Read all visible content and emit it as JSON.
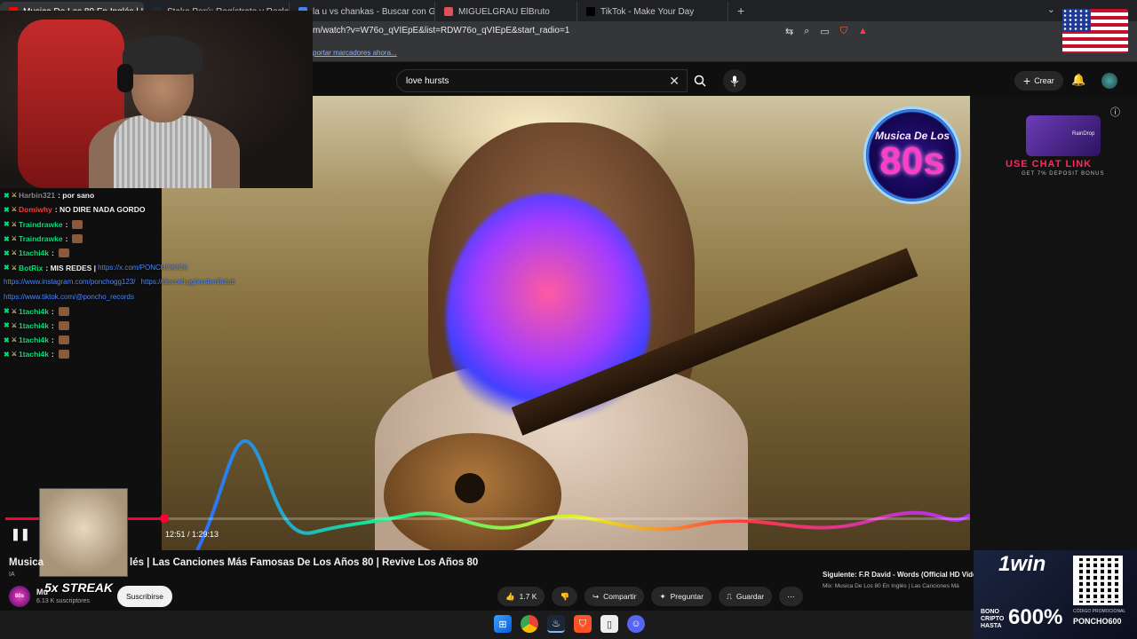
{
  "browser": {
    "tabs": [
      {
        "label": "Musica De Los 80 En Inglés | L",
        "active": true,
        "color": "#ff0000"
      },
      {
        "label": "Stake Perú: Regístrate y Reclama tu B",
        "active": false,
        "color": "#1a2c38"
      },
      {
        "label": "la u vs chankas - Buscar con Google",
        "active": false,
        "color": "#4285f4"
      },
      {
        "label": "MIGUELGRAU ElBruto",
        "active": false,
        "color": "#e0525a"
      },
      {
        "label": "TikTok - Make Your Day",
        "active": false,
        "color": "#000000"
      }
    ],
    "url": "m/watch?v=W76o_qVIEpE&list=RDW76o_qVIEpE&start_radio=1",
    "bookmark_link": "portar marcadores ahora..."
  },
  "youtube": {
    "search_value": "love hursts",
    "create_label": "Crear",
    "video": {
      "logo_top": "Musica De Los",
      "logo_number": "80s",
      "progress_fraction": 0.1645,
      "time_current": "12:51",
      "time_total": "1:29:13",
      "time_display": "12:51 / 1:29:13"
    },
    "title_left": "Musica",
    "title_right": "lés | Las Canciones Más Famosas De Los Años 80 | Revive Los Años 80",
    "ia_badge": "IA",
    "channel_name": "Mu",
    "subscribers": "6.13 K suscriptores",
    "subscribe_label": "Suscribirse",
    "likes": "1.7 K",
    "share_label": "Compartir",
    "ask_label": "Preguntar",
    "save_label": "Guardar",
    "next_label": "Siguiente: F.R David - Words (Official HD Vide",
    "next_sub": "Mix: Musica De Los 80 En Inglés | Las Canciones Má"
  },
  "stream": {
    "chat": [
      {
        "user": "Harbin321",
        "msg": ": por sano",
        "user_color": "#8a8a8a"
      },
      {
        "user": "Domiwhy",
        "msg": ": NO DIRE NADA GORDO",
        "user_color": "#ff3b3b"
      },
      {
        "user": "Traindrawke",
        "msg": ":",
        "user_color": "#00e07a",
        "emote": true
      },
      {
        "user": "Traindrawke",
        "msg": ":",
        "user_color": "#00e07a",
        "emote": true
      },
      {
        "user": "1tachi4k",
        "msg": ":",
        "user_color": "#00e07a",
        "emote": true
      },
      {
        "user": "BotRix",
        "msg": ": MIS REDES |",
        "user_color": "#00e07a",
        "link": "https://x.com/PONCHOKICK"
      },
      {
        "user": "",
        "msg": "",
        "user_color": "#4f8aff",
        "link": "https://www.instagram.com/ponchogg123/",
        "link2": "https://discord.gg/xw4wrBdtcb"
      },
      {
        "user": "",
        "msg": "",
        "user_color": "#4f8aff",
        "link": "https://www.tiktok.com/@poncho_records"
      },
      {
        "user": "1tachi4k",
        "msg": ":",
        "user_color": "#00e07a",
        "emote": true
      },
      {
        "user": "1tachi4k",
        "msg": ":",
        "user_color": "#00e07a",
        "emote": true
      },
      {
        "user": "1tachi4k",
        "msg": ":",
        "user_color": "#00e07a",
        "emote": true
      },
      {
        "user": "1tachi4k",
        "msg": ":",
        "user_color": "#00e07a",
        "emote": true
      }
    ],
    "streak": "5x STREAK",
    "ad_box_text": "RainDrop",
    "ad_code": "USE CHAT LINK",
    "ad_sub": "GET 7% DEPOSIT BONUS",
    "casino": {
      "brand": "1win",
      "bono": "BONO\nCRIPTO\nHASTA",
      "percent": "600%",
      "promo_label": "CÓDIGO PROMOCIONAL",
      "promo_code": "PONCHO600"
    }
  }
}
